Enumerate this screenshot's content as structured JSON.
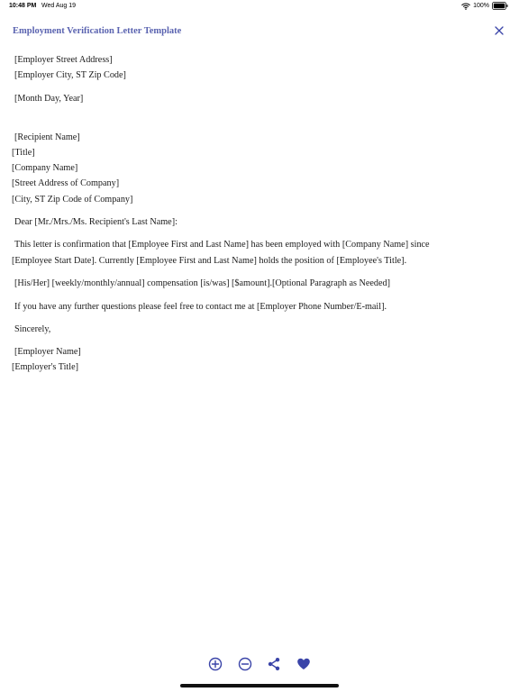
{
  "status_bar": {
    "time": "10:48 PM",
    "date": "Wed Aug 19",
    "battery": "100%",
    "icons": [
      "wifi-icon",
      "battery-icon"
    ]
  },
  "header": {
    "title": "Employment Verification Letter Template",
    "close_icon": "close-icon"
  },
  "letter": {
    "employer_street": "[Employer Street Address]",
    "employer_city": "[Employer City, ST Zip Code]",
    "date": "[Month Day, Year]",
    "recipient_name": "[Recipient Name]",
    "recipient_title": "[Title]",
    "company_name": "[Company Name]",
    "company_street": "[Street Address of Company]",
    "company_city": "[City, ST Zip Code of Company]",
    "salutation": "Dear [Mr./Mrs./Ms. Recipient's Last Name]:",
    "para1_line1": "This letter is confirmation that [Employee First and Last Name] has been employed with [Company Name] since",
    "para1_line2": "[Employee Start Date]. Currently [Employee First and Last Name] holds the position of [Employee's Title].",
    "para2": "[His/Her] [weekly/monthly/annual] compensation [is/was] [$amount].[Optional Paragraph as Needed]",
    "para3": "If you have any further questions please feel free to contact me at [Employer Phone Number/E-mail].",
    "closing": "Sincerely,",
    "employer_name": "[Employer Name]",
    "employer_title": "[Employer's Title]"
  },
  "toolbar": {
    "icons": [
      "zoom-in-icon",
      "zoom-out-icon",
      "share-icon",
      "heart-icon"
    ],
    "accent_color": "#3a44a8"
  }
}
